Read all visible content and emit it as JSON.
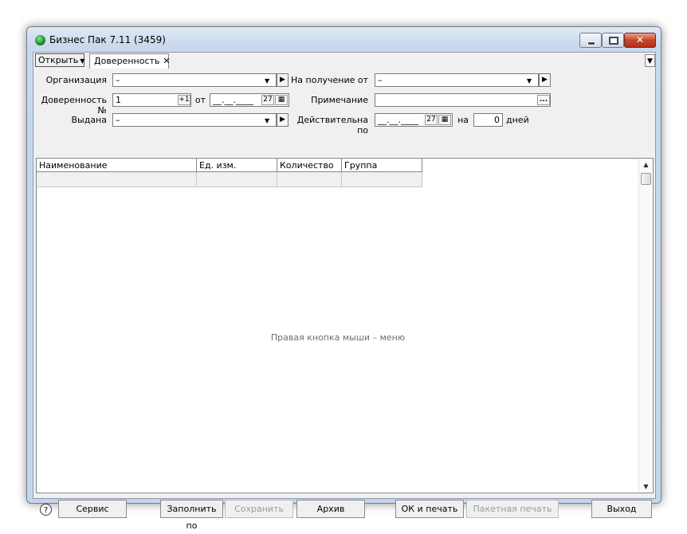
{
  "window": {
    "title": "Бизнес Пак 7.11 (3459)"
  },
  "tabbar": {
    "open_label": "Открыть",
    "tab_label": "Доверенность",
    "tab_close": "✕"
  },
  "form": {
    "org_label": "Организация",
    "org_value": "–",
    "poa_label": "Доверенность №",
    "poa_number": "1",
    "poa_inc": "+1",
    "from_label": "от",
    "date_mask": "__.__.____",
    "date_day": "27",
    "issued_label": "Выдана",
    "issued_value": "–",
    "receive_label": "На получение от",
    "receive_value": "–",
    "note_label": "Примечание",
    "note_value": "",
    "note_btn": "...",
    "valid_label": "Действительна по",
    "valid_date_mask": "__.__.____",
    "valid_day": "27",
    "on_label": "на",
    "days_value": "0",
    "days_label": "дней"
  },
  "grid": {
    "columns": [
      "Наименование",
      "Ед. изм.",
      "Количество",
      "Группа"
    ],
    "hint": "Правая кнопка мыши – меню"
  },
  "buttons": {
    "help": "?",
    "service": "Сервис",
    "fill_by": "Заполнить по",
    "save": "Сохранить",
    "archive": "Архив",
    "ok_print": "ОК и печать",
    "batch_print": "Пакетная печать",
    "exit": "Выход"
  }
}
